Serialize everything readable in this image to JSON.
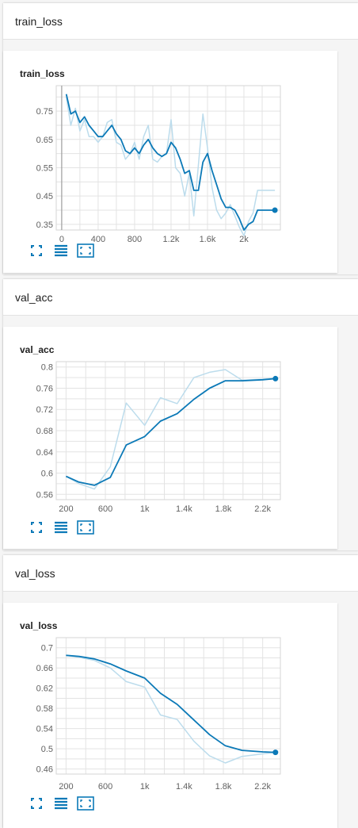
{
  "colors": {
    "accent": "#0b79b7",
    "smoothed_line": "#0b79b7",
    "raw_line": "#bcdcec",
    "grid": "#e3e3e3",
    "axis_zero": "#9e9e9e"
  },
  "icons": {
    "fit": "expand-corners-icon",
    "log": "list-lines-icon",
    "reset": "fit-domain-icon"
  },
  "sections": [
    {
      "name": "train_loss",
      "card_title": "train_loss"
    },
    {
      "name": "val_acc",
      "card_title": "val_acc"
    },
    {
      "name": "val_loss",
      "card_title": "val_loss"
    }
  ],
  "chart_data": [
    {
      "type": "line",
      "title": "train_loss",
      "xlim": [
        -60,
        2400
      ],
      "ylim": [
        0.33,
        0.84
      ],
      "xticks": [
        0,
        400,
        800,
        1200,
        1600,
        2000
      ],
      "xtick_labels": [
        "0",
        "400",
        "800",
        "1.2k",
        "1.6k",
        "2k"
      ],
      "yticks": [
        0.35,
        0.45,
        0.55,
        0.65,
        0.75
      ],
      "ytick_labels": [
        "0.35",
        "0.45",
        "0.55",
        "0.65",
        "0.75"
      ],
      "series": [
        {
          "style": "smoothed",
          "x": [
            50,
            100,
            150,
            200,
            250,
            300,
            350,
            400,
            450,
            500,
            550,
            600,
            650,
            700,
            750,
            800,
            850,
            900,
            950,
            1000,
            1050,
            1100,
            1150,
            1200,
            1250,
            1300,
            1350,
            1400,
            1450,
            1500,
            1550,
            1600,
            1650,
            1700,
            1750,
            1800,
            1850,
            1900,
            1950,
            2000,
            2050,
            2100,
            2150,
            2200,
            2250,
            2300,
            2340
          ],
          "y": [
            0.81,
            0.74,
            0.75,
            0.71,
            0.73,
            0.7,
            0.68,
            0.66,
            0.66,
            0.68,
            0.7,
            0.67,
            0.65,
            0.61,
            0.6,
            0.62,
            0.6,
            0.63,
            0.65,
            0.62,
            0.6,
            0.59,
            0.6,
            0.64,
            0.62,
            0.58,
            0.53,
            0.54,
            0.47,
            0.47,
            0.57,
            0.6,
            0.54,
            0.49,
            0.44,
            0.41,
            0.41,
            0.4,
            0.37,
            0.33,
            0.35,
            0.36,
            0.4,
            0.4,
            0.4,
            0.4,
            0.4
          ]
        },
        {
          "style": "raw",
          "x": [
            50,
            100,
            150,
            200,
            250,
            300,
            350,
            400,
            450,
            500,
            550,
            600,
            650,
            700,
            750,
            800,
            850,
            900,
            950,
            1000,
            1050,
            1100,
            1150,
            1200,
            1250,
            1300,
            1350,
            1400,
            1450,
            1500,
            1550,
            1600,
            1650,
            1700,
            1750,
            1800,
            1850,
            1900,
            1950,
            2000,
            2050,
            2100,
            2150,
            2200,
            2250,
            2300,
            2340
          ],
          "y": [
            0.8,
            0.7,
            0.76,
            0.68,
            0.72,
            0.66,
            0.66,
            0.64,
            0.66,
            0.71,
            0.72,
            0.64,
            0.63,
            0.58,
            0.6,
            0.64,
            0.58,
            0.66,
            0.7,
            0.58,
            0.57,
            0.59,
            0.6,
            0.72,
            0.55,
            0.53,
            0.45,
            0.53,
            0.38,
            0.56,
            0.74,
            0.62,
            0.48,
            0.4,
            0.37,
            0.39,
            0.42,
            0.38,
            0.34,
            0.31,
            0.36,
            0.39,
            0.47,
            0.47,
            0.47,
            0.47,
            0.47
          ]
        }
      ],
      "last_point": {
        "x": 2340,
        "y": 0.4
      }
    },
    {
      "type": "line",
      "title": "val_acc",
      "xlim": [
        100,
        2380
      ],
      "ylim": [
        0.55,
        0.81
      ],
      "xticks": [
        200,
        600,
        1000,
        1400,
        1800,
        2200
      ],
      "xtick_labels": [
        "200",
        "600",
        "1k",
        "1.4k",
        "1.8k",
        "2.2k"
      ],
      "yticks": [
        0.56,
        0.6,
        0.64,
        0.68,
        0.72,
        0.76,
        0.8
      ],
      "ytick_labels": [
        "0.56",
        "0.6",
        "0.64",
        "0.68",
        "0.72",
        "0.76",
        "0.8"
      ],
      "series": [
        {
          "style": "smoothed",
          "x": [
            200,
            332,
            488,
            650,
            812,
            1000,
            1160,
            1330,
            1500,
            1660,
            1820,
            1990,
            2200,
            2330
          ],
          "y": [
            0.594,
            0.583,
            0.577,
            0.592,
            0.653,
            0.669,
            0.698,
            0.712,
            0.739,
            0.76,
            0.774,
            0.774,
            0.776,
            0.778
          ]
        },
        {
          "style": "raw",
          "x": [
            200,
            332,
            488,
            650,
            812,
            1000,
            1160,
            1330,
            1500,
            1660,
            1820,
            1990,
            2200,
            2330
          ],
          "y": [
            0.594,
            0.58,
            0.57,
            0.612,
            0.732,
            0.69,
            0.742,
            0.731,
            0.78,
            0.79,
            0.795,
            0.775,
            0.777,
            0.779
          ]
        }
      ],
      "last_point": {
        "x": 2330,
        "y": 0.778
      }
    },
    {
      "type": "line",
      "title": "val_loss",
      "xlim": [
        100,
        2380
      ],
      "ylim": [
        0.45,
        0.72
      ],
      "xticks": [
        200,
        600,
        1000,
        1400,
        1800,
        2200
      ],
      "xtick_labels": [
        "200",
        "600",
        "1k",
        "1.4k",
        "1.8k",
        "2.2k"
      ],
      "yticks": [
        0.46,
        0.5,
        0.54,
        0.58,
        0.62,
        0.66,
        0.7
      ],
      "ytick_labels": [
        "0.46",
        "0.5",
        "0.54",
        "0.58",
        "0.62",
        "0.66",
        "0.7"
      ],
      "series": [
        {
          "style": "smoothed",
          "x": [
            200,
            332,
            488,
            650,
            812,
            1000,
            1160,
            1330,
            1500,
            1660,
            1820,
            1990,
            2200,
            2330
          ],
          "y": [
            0.685,
            0.683,
            0.678,
            0.668,
            0.654,
            0.64,
            0.61,
            0.588,
            0.557,
            0.528,
            0.506,
            0.497,
            0.494,
            0.493
          ]
        },
        {
          "style": "raw",
          "x": [
            200,
            332,
            488,
            650,
            812,
            1000,
            1160,
            1330,
            1500,
            1660,
            1820,
            1990,
            2200,
            2330
          ],
          "y": [
            0.685,
            0.681,
            0.675,
            0.66,
            0.633,
            0.622,
            0.567,
            0.558,
            0.515,
            0.486,
            0.472,
            0.485,
            0.49,
            0.493
          ]
        }
      ],
      "last_point": {
        "x": 2330,
        "y": 0.493
      }
    }
  ]
}
